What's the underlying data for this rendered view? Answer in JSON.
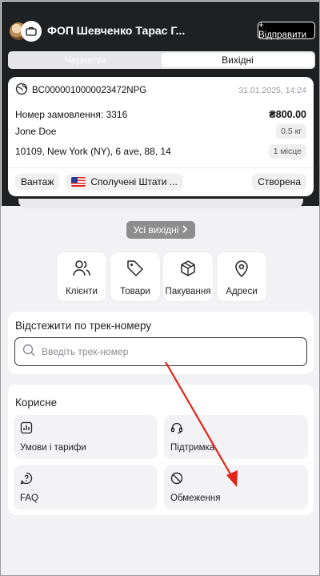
{
  "header": {
    "company": "ФОП Шевченко Тарас Г...",
    "send_label": "+ Відправити"
  },
  "tabs": [
    {
      "label": "Чернетки",
      "active": false
    },
    {
      "label": "Вихідні",
      "active": true
    }
  ],
  "order": {
    "tracking_number": "BC0000010000023472NPG",
    "date": "31.01.2025, 14:24",
    "order_number": "Номер замовлення: 3316",
    "price": "₴800.00",
    "recipient": "Jone Doe",
    "weight": "0.5 кг",
    "address": "10109, New York (NY), 6 ave, 88, 14",
    "places": "1 місце",
    "type": "Вантаж",
    "country": "Сполучені Штати ...",
    "status": "Створена"
  },
  "all_outgoing_label": "Усі вихідні",
  "quick_tiles": [
    {
      "label": "Клієнти",
      "icon": "users-icon"
    },
    {
      "label": "Товари",
      "icon": "tag-icon"
    },
    {
      "label": "Пакування",
      "icon": "box-icon"
    },
    {
      "label": "Адреси",
      "icon": "map-pin-icon"
    }
  ],
  "tracking": {
    "title": "Відстежити по трек-номеру",
    "placeholder": "Введіть трек-номер"
  },
  "useful": {
    "title": "Корисне",
    "items": [
      {
        "label": "Умови і тарифи",
        "icon": "chart-icon"
      },
      {
        "label": "Підтримка",
        "icon": "headset-icon"
      },
      {
        "label": "FAQ",
        "icon": "question-icon"
      },
      {
        "label": "Обмеження",
        "icon": "prohibited-icon"
      }
    ]
  },
  "colors": {
    "header_bg": "#1f2022",
    "page_bg": "#f2f2f4",
    "arrow": "#e3241b"
  }
}
